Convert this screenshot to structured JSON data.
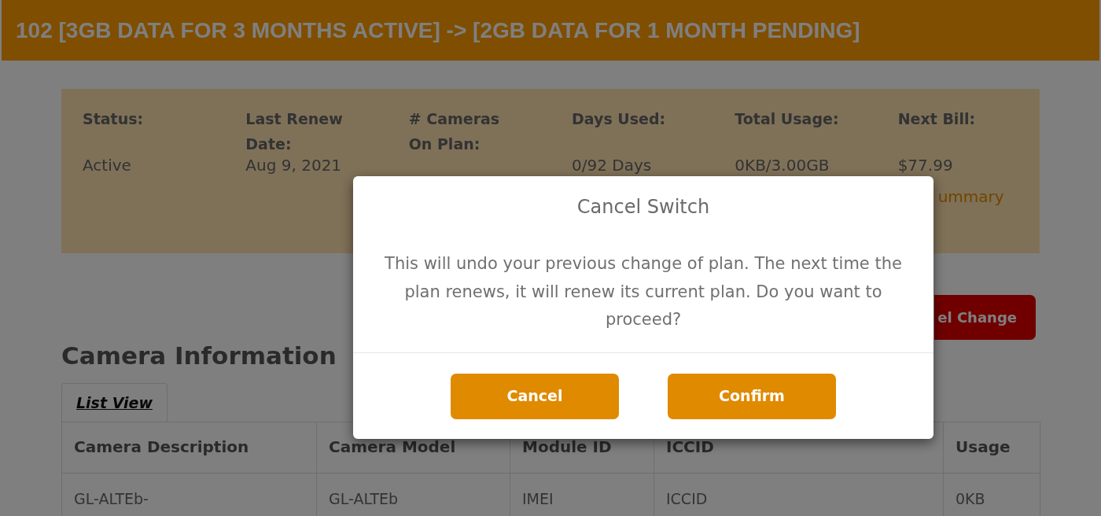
{
  "header": {
    "title": "102 [3GB DATA FOR 3 MONTHS ACTIVE] -> [2GB DATA FOR 1 MONTH PENDING]"
  },
  "summary": {
    "fields": [
      {
        "label": "Status:",
        "value": "Active"
      },
      {
        "label": "Last Renew Date:",
        "value": "Aug 9, 2021"
      },
      {
        "label": "# Cameras On Plan:"
      },
      {
        "label": "Days Used:",
        "value": "0/92 Days"
      },
      {
        "label": "Total Usage:",
        "value": "0KB/3.00GB"
      },
      {
        "label": "Next Bill:",
        "value": "$77.99",
        "link": "ummary"
      }
    ]
  },
  "button": {
    "label": "el Change"
  },
  "camera_section": {
    "heading": "Camera Information",
    "tabs": [
      {
        "label": "List View",
        "selected": true
      }
    ],
    "table": {
      "columns": [
        "Camera Description",
        "Camera Model",
        "Module ID",
        "ICCID",
        "Usage"
      ],
      "rows": [
        [
          "GL-ALTEb-",
          "GL-ALTEb",
          "IMEI",
          "ICCID",
          "0KB"
        ]
      ]
    }
  },
  "dialog": {
    "title": "Cancel Switch",
    "message": "This will undo your previous change of plan. The next time the plan renews, it will renew its current plan. Do you want to proceed?",
    "buttons": [
      "Cancel",
      "Confirm"
    ]
  }
}
